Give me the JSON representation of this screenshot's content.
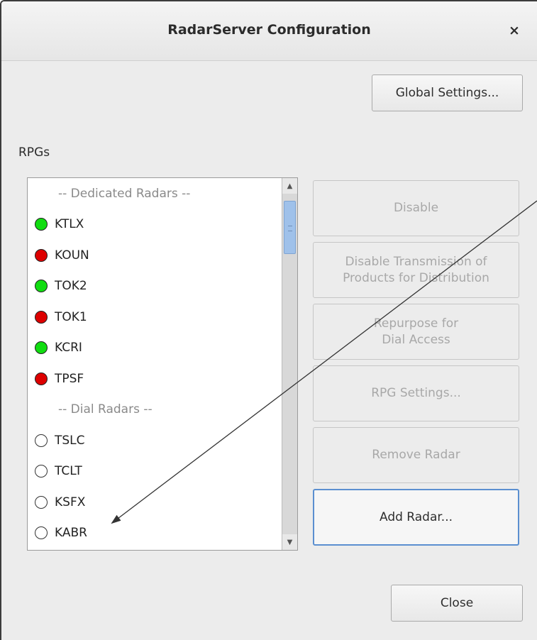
{
  "window": {
    "title": "RadarServer Configuration",
    "close_glyph": "×"
  },
  "global_settings_label": "Global Settings...",
  "rpgs_label": "RPGs",
  "rpg_list": [
    {
      "type": "header",
      "label": "-- Dedicated Radars --"
    },
    {
      "type": "radar",
      "label": "KTLX",
      "status": "green"
    },
    {
      "type": "radar",
      "label": "KOUN",
      "status": "red"
    },
    {
      "type": "radar",
      "label": "TOK2",
      "status": "green"
    },
    {
      "type": "radar",
      "label": "TOK1",
      "status": "red"
    },
    {
      "type": "radar",
      "label": "KCRI",
      "status": "green"
    },
    {
      "type": "radar",
      "label": "TPSF",
      "status": "red"
    },
    {
      "type": "header",
      "label": "-- Dial Radars --"
    },
    {
      "type": "radar",
      "label": "TSLC",
      "status": "none"
    },
    {
      "type": "radar",
      "label": "TCLT",
      "status": "none"
    },
    {
      "type": "radar",
      "label": "KSFX",
      "status": "none"
    },
    {
      "type": "radar",
      "label": "KABR",
      "status": "none"
    },
    {
      "type": "radar",
      "label": "",
      "status": "none"
    }
  ],
  "status_colors": {
    "green": "#11dd11",
    "red": "#dd0000",
    "none": "#ffffff"
  },
  "buttons": {
    "disable": "Disable",
    "disable_transmission_line1": "Disable Transmission of",
    "disable_transmission_line2": "Products for Distribution",
    "repurpose_line1": "Repurpose for",
    "repurpose_line2": "Dial Access",
    "rpg_settings": "RPG Settings...",
    "remove_radar": "Remove Radar",
    "add_radar": "Add Radar...",
    "close": "Close"
  }
}
